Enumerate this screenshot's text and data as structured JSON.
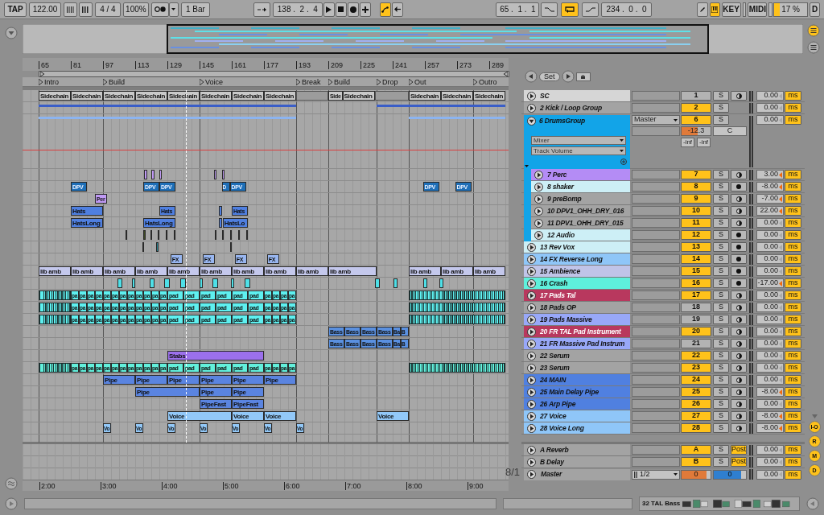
{
  "transport": {
    "tap": "TAP",
    "tempo": "122.00",
    "signature": "4 / 4",
    "zoom": "100%",
    "quantize": "1 Bar",
    "position": "138 .  2 .  4",
    "automation_arm": true,
    "loop_start": "65 .  1 .  1",
    "punch_in": false,
    "loop": true,
    "punch_out": false,
    "loop_length": "234 .  0 .  0",
    "key_map": true,
    "key": "KEY",
    "midi": "MIDI",
    "cpu_meter": {
      "reading": "17 %",
      "level": 0.17
    },
    "disk": "D"
  },
  "ruler": [
    "65",
    "81",
    "97",
    "113",
    "129",
    "145",
    "161",
    "177",
    "193",
    "209",
    "225",
    "241",
    "257",
    "273",
    "289"
  ],
  "locators": [
    "Intro",
    "Build",
    "Voice",
    "Break",
    "Build",
    "Drop",
    "Out",
    "Outro"
  ],
  "set_label": "Set",
  "grid": "8/1",
  "tracks": [
    {
      "name": "SC",
      "color": "#d6d6d6",
      "kind": "midi",
      "number": "1",
      "active": false,
      "solo": "S",
      "delay": "0.00",
      "modified": false,
      "unit": "ms",
      "clips": [
        {
          "kind": "audio",
          "name": "Sidechain"
        },
        {
          "kind": "audio",
          "name": "Sidechain"
        },
        {
          "kind": "audio",
          "name": "Sidechain"
        },
        {
          "kind": "audio",
          "name": "Sidechain"
        },
        {
          "kind": "audio",
          "name": "Sidechain"
        },
        {
          "kind": "audio",
          "name": "Sidechain"
        },
        {
          "kind": "audio",
          "name": "Sidechain"
        },
        {
          "kind": "audio",
          "name": "Sidechain"
        },
        {
          "kind": "empty"
        },
        {
          "kind": "audio",
          "name": "Side"
        },
        {
          "kind": "audio",
          "name": "Sidechain"
        },
        {
          "kind": "empty"
        },
        {
          "kind": "audio",
          "name": "Sidechain"
        },
        {
          "kind": "audio",
          "name": "Sidechain"
        },
        {
          "kind": "audio",
          "name": "Sidechain"
        }
      ]
    },
    {
      "name": "2 Kick / Loop Group",
      "color": "#a3a3a3",
      "kind": "group",
      "expanded": false,
      "number": "2",
      "active": true,
      "solo": "S",
      "delay": "0.00",
      "modified": false,
      "unit": "ms",
      "clips": [
        {
          "kind": "summary"
        },
        {
          "kind": "summary"
        }
      ]
    },
    {
      "name": "6 DrumsGroup",
      "color": "#12a4e8",
      "kind": "group",
      "expanded": true,
      "number": "6",
      "active": true,
      "solo": "S",
      "delay": "0.00",
      "modified": false,
      "unit": "ms",
      "output": "Master",
      "mixer": "Mixer",
      "parameter": "Track Volume",
      "volume": {
        "reading": "-12.3",
        "level": 0.55
      },
      "pan": "C",
      "peaks": [
        "-inf",
        "-inf"
      ],
      "clips": [
        {
          "kind": "summary"
        },
        {
          "kind": "summary"
        }
      ],
      "children": [
        {
          "name": "7 Perc",
          "color": "#b48cf5",
          "kind": "midi",
          "number": "7",
          "active": true,
          "solo": "S",
          "delay": "3.00",
          "modified": true,
          "unit": "ms",
          "clips": [
            {
              "kind": "audio"
            },
            {
              "kind": "audio"
            },
            {
              "kind": "audio"
            },
            {
              "kind": "audio"
            },
            {
              "kind": "audio"
            }
          ]
        },
        {
          "name": "8 shaker",
          "color": "#cdeff6",
          "kind": "audio",
          "number": "8",
          "active": true,
          "solo": "S",
          "delay": "-8.00",
          "modified": true,
          "unit": "ms",
          "clips": [
            {
              "kind": "audio",
              "name": "DPV"
            },
            {
              "kind": "audio",
              "name": "DPV"
            },
            {
              "kind": "audio",
              "name": "DPV"
            },
            {
              "kind": "audio",
              "name": "D"
            },
            {
              "kind": "audio",
              "name": "DPV"
            },
            {
              "kind": "audio",
              "name": "DPV"
            },
            {
              "kind": "audio",
              "name": "DPV"
            }
          ]
        },
        {
          "name": "9 preBomp",
          "color": "#a3a3a3",
          "kind": "midi",
          "number": "9",
          "active": true,
          "solo": "S",
          "delay": "-7.00",
          "modified": true,
          "unit": "ms",
          "clips": [
            {
              "kind": "audio",
              "name": "Per"
            }
          ]
        },
        {
          "name": "10 DPV1_OHH_DRY_016",
          "color": "#a3a3a3",
          "kind": "midi",
          "number": "10",
          "active": true,
          "solo": "S",
          "delay": "22.00",
          "modified": true,
          "unit": "ms",
          "clips": [
            {
              "kind": "audio",
              "name": "Hats"
            },
            {
              "kind": "audio",
              "name": "Hats"
            },
            {
              "kind": "audio"
            },
            {
              "kind": "audio",
              "name": "Hats"
            }
          ]
        },
        {
          "name": "11 DPV1_OHH_DRY_015",
          "color": "#a3a3a3",
          "kind": "midi",
          "number": "11",
          "active": true,
          "solo": "S",
          "delay": "0.00",
          "modified": false,
          "unit": "ms",
          "clips": [
            {
              "kind": "audio",
              "name": "HatsLong"
            },
            {
              "kind": "audio",
              "name": "HatsLong"
            },
            {
              "kind": "audio"
            },
            {
              "kind": "audio",
              "name": "HatsLo"
            }
          ]
        },
        {
          "name": "12 Audio",
          "color": "#cdeff6",
          "kind": "audio",
          "number": "12",
          "active": true,
          "solo": "S",
          "delay": "0.00",
          "modified": false,
          "unit": "ms",
          "clips": [
            {
              "kind": "audio"
            },
            {
              "kind": "audio"
            },
            {
              "kind": "audio"
            },
            {
              "kind": "audio"
            },
            {
              "kind": "audio"
            },
            {
              "kind": "audio"
            },
            {
              "kind": "audio"
            },
            {
              "kind": "audio"
            },
            {
              "kind": "audio"
            },
            {
              "kind": "audio"
            },
            {
              "kind": "audio"
            }
          ]
        }
      ]
    },
    {
      "name": "13 Rev Vox",
      "color": "#cdeff6",
      "kind": "audio",
      "number": "13",
      "active": true,
      "solo": "S",
      "delay": "0.00",
      "modified": false,
      "unit": "ms",
      "clips": [
        {
          "kind": "audio"
        },
        {
          "kind": "audio"
        },
        {
          "kind": "audio"
        }
      ]
    },
    {
      "name": "14 FX Reverse Long",
      "color": "#8fc6f8",
      "kind": "audio",
      "number": "14",
      "active": true,
      "solo": "S",
      "delay": "0.00",
      "modified": false,
      "unit": "ms",
      "clips": [
        {
          "kind": "audio",
          "name": "FX"
        },
        {
          "kind": "audio",
          "name": "FX"
        },
        {
          "kind": "audio",
          "name": "FX"
        },
        {
          "kind": "audio",
          "name": "FX"
        }
      ]
    },
    {
      "name": "15 Ambience",
      "color": "#c0c4e8",
      "kind": "audio",
      "number": "15",
      "active": true,
      "solo": "S",
      "delay": "0.00",
      "modified": false,
      "unit": "ms",
      "clips": [
        {
          "kind": "audio",
          "name": "lib amb"
        },
        {
          "kind": "audio",
          "name": "lib amb"
        },
        {
          "kind": "audio",
          "name": "lib amb"
        },
        {
          "kind": "audio",
          "name": "lib amb"
        },
        {
          "kind": "audio",
          "name": "lib amb"
        },
        {
          "kind": "audio",
          "name": "lib amb"
        },
        {
          "kind": "audio",
          "name": "lib amb"
        },
        {
          "kind": "audio",
          "name": "lib amb"
        },
        {
          "kind": "audio",
          "name": "lib amb"
        },
        {
          "kind": "audio",
          "name": "lib amb"
        },
        {
          "kind": "audio",
          "name": "lib amb"
        },
        {
          "kind": "audio",
          "name": "lib amb"
        },
        {
          "kind": "audio",
          "name": "lib amb"
        }
      ]
    },
    {
      "name": "16 Crash",
      "color": "#5ef0dc",
      "kind": "audio",
      "number": "16",
      "active": true,
      "solo": "S",
      "delay": "-17.00",
      "modified": true,
      "unit": "ms",
      "clips": [
        {
          "kind": "audio"
        },
        {
          "kind": "audio"
        },
        {
          "kind": "audio"
        },
        {
          "kind": "audio"
        },
        {
          "kind": "audio"
        },
        {
          "kind": "audio"
        },
        {
          "kind": "audio"
        },
        {
          "kind": "audio"
        },
        {
          "kind": "audio"
        },
        {
          "kind": "audio"
        },
        {
          "kind": "audio"
        },
        {
          "kind": "audio"
        },
        {
          "kind": "audio"
        }
      ]
    },
    {
      "name": "17 Pads Tal",
      "color": "#b8385e",
      "kind": "midi",
      "number": "17",
      "active": true,
      "solo": "S",
      "delay": "0.00",
      "modified": false,
      "unit": "ms",
      "clips": [
        {
          "kind": "striped"
        },
        {
          "kind": "audio",
          "name": "pa"
        },
        {
          "kind": "audio",
          "name": "pa"
        },
        {
          "kind": "audio",
          "name": "pa"
        },
        {
          "kind": "audio",
          "name": "pa"
        },
        {
          "kind": "audio",
          "name": "pa"
        },
        {
          "kind": "audio",
          "name": "pa"
        },
        {
          "kind": "audio",
          "name": "pa"
        },
        {
          "kind": "audio",
          "name": "pa"
        },
        {
          "kind": "audio",
          "name": "pa"
        },
        {
          "kind": "audio",
          "name": "pa"
        },
        {
          "kind": "audio",
          "name": "pa"
        },
        {
          "kind": "audio",
          "name": "pa"
        },
        {
          "kind": "audio",
          "name": "pad"
        },
        {
          "kind": "audio",
          "name": "pad"
        },
        {
          "kind": "audio",
          "name": "pad"
        },
        {
          "kind": "audio",
          "name": "pad"
        },
        {
          "kind": "audio",
          "name": "pad"
        },
        {
          "kind": "audio",
          "name": "pad"
        },
        {
          "kind": "audio",
          "name": "pa"
        },
        {
          "kind": "audio",
          "name": "pa"
        },
        {
          "kind": "audio",
          "name": "pa"
        },
        {
          "kind": "audio",
          "name": "pa"
        },
        {
          "kind": "striped"
        }
      ]
    },
    {
      "name": "18 Pads OP",
      "color": "#a3a3a3",
      "kind": "midi",
      "number": "18",
      "active": false,
      "solo": "S",
      "delay": "0.00",
      "modified": false,
      "unit": "ms",
      "clips": [
        {
          "kind": "striped"
        },
        {
          "kind": "audio",
          "name": "pa"
        },
        {
          "kind": "audio",
          "name": "pa"
        },
        {
          "kind": "audio",
          "name": "pa"
        },
        {
          "kind": "audio",
          "name": "pa"
        },
        {
          "kind": "audio",
          "name": "pa"
        },
        {
          "kind": "audio",
          "name": "pa"
        },
        {
          "kind": "audio",
          "name": "pa"
        },
        {
          "kind": "audio",
          "name": "pa"
        },
        {
          "kind": "audio",
          "name": "pa"
        },
        {
          "kind": "audio",
          "name": "pa"
        },
        {
          "kind": "audio",
          "name": "pa"
        },
        {
          "kind": "audio",
          "name": "pa"
        },
        {
          "kind": "audio",
          "name": "pad"
        },
        {
          "kind": "audio",
          "name": "pad"
        },
        {
          "kind": "audio",
          "name": "pad"
        },
        {
          "kind": "audio",
          "name": "pad"
        },
        {
          "kind": "audio",
          "name": "pad"
        },
        {
          "kind": "audio",
          "name": "pad"
        },
        {
          "kind": "audio",
          "name": "pa"
        },
        {
          "kind": "audio",
          "name": "pa"
        },
        {
          "kind": "audio",
          "name": "pa"
        },
        {
          "kind": "audio",
          "name": "pa"
        },
        {
          "kind": "striped"
        }
      ]
    },
    {
      "name": "19 Pads Massive",
      "color": "#98a8f8",
      "kind": "midi",
      "number": "19",
      "active": false,
      "solo": "S",
      "delay": "0.00",
      "modified": false,
      "unit": "ms",
      "clips": [
        {
          "kind": "striped"
        },
        {
          "kind": "audio",
          "name": "pa"
        },
        {
          "kind": "audio",
          "name": "pa"
        },
        {
          "kind": "audio",
          "name": "pa"
        },
        {
          "kind": "audio",
          "name": "pa"
        },
        {
          "kind": "audio",
          "name": "pa"
        },
        {
          "kind": "audio",
          "name": "pa"
        },
        {
          "kind": "audio",
          "name": "pa"
        },
        {
          "kind": "audio",
          "name": "pa"
        },
        {
          "kind": "audio",
          "name": "pa"
        },
        {
          "kind": "audio",
          "name": "pa"
        },
        {
          "kind": "audio",
          "name": "pa"
        },
        {
          "kind": "audio",
          "name": "pa"
        },
        {
          "kind": "audio",
          "name": "pad"
        },
        {
          "kind": "audio",
          "name": "pad"
        },
        {
          "kind": "audio",
          "name": "pad"
        },
        {
          "kind": "audio",
          "name": "pad"
        },
        {
          "kind": "audio",
          "name": "pad"
        },
        {
          "kind": "audio",
          "name": "pad"
        },
        {
          "kind": "audio",
          "name": "pa"
        },
        {
          "kind": "audio",
          "name": "pa"
        },
        {
          "kind": "audio",
          "name": "pa"
        },
        {
          "kind": "audio",
          "name": "pa"
        },
        {
          "kind": "striped"
        }
      ]
    },
    {
      "name": "20 FR TAL Pad Instrument",
      "color": "#b8385e",
      "kind": "midi",
      "number": "20",
      "active": true,
      "solo": "S",
      "delay": "0.00",
      "modified": false,
      "unit": "ms",
      "clips": [
        {
          "kind": "audio",
          "name": "Bass"
        },
        {
          "kind": "audio",
          "name": "Bass"
        },
        {
          "kind": "audio",
          "name": "Bass"
        },
        {
          "kind": "audio",
          "name": "Bass"
        },
        {
          "kind": "audio",
          "name": "Ba"
        },
        {
          "kind": "audio",
          "name": "B"
        }
      ]
    },
    {
      "name": "21 FR Massive Pad Instrum",
      "color": "#98a8f8",
      "kind": "midi",
      "number": "21",
      "active": false,
      "solo": "S",
      "delay": "0.00",
      "modified": false,
      "unit": "ms",
      "clips": [
        {
          "kind": "audio",
          "name": "Bass"
        },
        {
          "kind": "audio",
          "name": "Bass"
        },
        {
          "kind": "audio",
          "name": "Bass"
        },
        {
          "kind": "audio",
          "name": "Bass"
        },
        {
          "kind": "audio",
          "name": "Ba"
        },
        {
          "kind": "audio",
          "name": "B"
        }
      ]
    },
    {
      "name": "22 Serum",
      "color": "#a3a3a3",
      "kind": "midi",
      "number": "22",
      "active": true,
      "solo": "S",
      "delay": "0.00",
      "modified": false,
      "unit": "ms",
      "clips": [
        {
          "kind": "audio",
          "name": "Stabs"
        }
      ]
    },
    {
      "name": "23 Serum",
      "color": "#a3a3a3",
      "kind": "midi",
      "number": "23",
      "active": true,
      "solo": "S",
      "delay": "0.00",
      "modified": false,
      "unit": "ms",
      "clips": [
        {
          "kind": "striped"
        },
        {
          "kind": "audio",
          "name": "pa"
        },
        {
          "kind": "audio",
          "name": "pa"
        },
        {
          "kind": "audio",
          "name": "pa"
        },
        {
          "kind": "audio",
          "name": "pa"
        },
        {
          "kind": "audio",
          "name": "pa"
        },
        {
          "kind": "audio",
          "name": "pa"
        },
        {
          "kind": "audio",
          "name": "pa"
        },
        {
          "kind": "audio",
          "name": "pa"
        },
        {
          "kind": "audio",
          "name": "pa"
        },
        {
          "kind": "audio",
          "name": "pa"
        },
        {
          "kind": "audio",
          "name": "pa"
        },
        {
          "kind": "audio",
          "name": "pa"
        },
        {
          "kind": "audio",
          "name": "pad"
        },
        {
          "kind": "audio",
          "name": "pad"
        },
        {
          "kind": "audio",
          "name": "pad"
        },
        {
          "kind": "audio",
          "name": "pad"
        },
        {
          "kind": "audio",
          "name": "pad"
        },
        {
          "kind": "audio",
          "name": "pad"
        },
        {
          "kind": "audio",
          "name": "pa"
        },
        {
          "kind": "audio",
          "name": "pa"
        },
        {
          "kind": "audio",
          "name": "pa"
        },
        {
          "kind": "audio",
          "name": "pa"
        },
        {
          "kind": "striped"
        }
      ]
    },
    {
      "name": "24 MAIN",
      "color": "#5080e0",
      "kind": "midi",
      "number": "24",
      "active": true,
      "solo": "S",
      "delay": "0.00",
      "modified": false,
      "unit": "ms",
      "clips": [
        {
          "kind": "audio",
          "name": "Pipe"
        },
        {
          "kind": "audio",
          "name": "Pipe"
        },
        {
          "kind": "audio",
          "name": "Pipe"
        },
        {
          "kind": "audio",
          "name": "Pipe"
        },
        {
          "kind": "audio",
          "name": "Pipe"
        },
        {
          "kind": "audio",
          "name": "Pipe"
        }
      ]
    },
    {
      "name": "25 Main Delay Pipe",
      "color": "#5080e0",
      "kind": "midi",
      "number": "25",
      "active": true,
      "solo": "S",
      "delay": "-8.00",
      "modified": true,
      "unit": "ms",
      "clips": [
        {
          "kind": "audio",
          "name": "Pipe"
        },
        {
          "kind": "audio",
          "name": "Pipe"
        },
        {
          "kind": "audio",
          "name": "Pipe"
        }
      ]
    },
    {
      "name": "26 Arp Pipe",
      "color": "#5080e0",
      "kind": "midi",
      "number": "26",
      "active": true,
      "solo": "S",
      "delay": "0.00",
      "modified": false,
      "unit": "ms",
      "clips": [
        {
          "kind": "audio",
          "name": "PipeFast"
        },
        {
          "kind": "audio",
          "name": "PipeFast"
        }
      ]
    },
    {
      "name": "27 Voice",
      "color": "#8fc6f8",
      "kind": "midi",
      "number": "27",
      "active": true,
      "solo": "S",
      "delay": "-8.00",
      "modified": true,
      "unit": "ms",
      "clips": [
        {
          "kind": "audio",
          "name": "Voice"
        },
        {
          "kind": "audio",
          "name": "Voice"
        },
        {
          "kind": "audio",
          "name": "Voice"
        },
        {
          "kind": "audio",
          "name": "Voice"
        }
      ]
    },
    {
      "name": "28 Voice Long",
      "color": "#8fc6f8",
      "kind": "midi",
      "number": "28",
      "active": true,
      "solo": "S",
      "delay": "-8.00",
      "modified": true,
      "unit": "ms",
      "clips": [
        {
          "kind": "audio",
          "name": "Vo"
        },
        {
          "kind": "audio",
          "name": "Vo"
        },
        {
          "kind": "audio",
          "name": "Vo"
        },
        {
          "kind": "audio",
          "name": "Vo"
        },
        {
          "kind": "audio",
          "name": "Vo"
        },
        {
          "kind": "audio",
          "name": "Vo"
        },
        {
          "kind": "audio",
          "name": "Vo"
        }
      ]
    }
  ],
  "returns": [
    {
      "name": "A Reverb",
      "number": "A",
      "active": true,
      "solo": "S",
      "post": "Post",
      "post_on": true,
      "delay": "0.00",
      "modified": false,
      "unit": "ms"
    },
    {
      "name": "B Delay",
      "number": "B",
      "active": true,
      "solo": "S",
      "post": "Post",
      "post_on": true,
      "delay": "0.00",
      "modified": false,
      "unit": "ms"
    }
  ],
  "master": {
    "name": "Master",
    "output": "1/2",
    "volume": {
      "reading": "0",
      "level": 0.85
    },
    "pan": {
      "reading": "0",
      "level": 0.85
    },
    "delay": "0.00",
    "modified": false,
    "unit": "ms"
  },
  "time_ruler": [
    "2:00",
    "3:00",
    "4:00",
    "5:00",
    "6:00",
    "7:00",
    "8:00",
    "9:00"
  ],
  "side_buttons": [
    "I-O",
    "R",
    "M",
    "D"
  ],
  "status": {
    "device_track": "32 TAL Bass"
  }
}
